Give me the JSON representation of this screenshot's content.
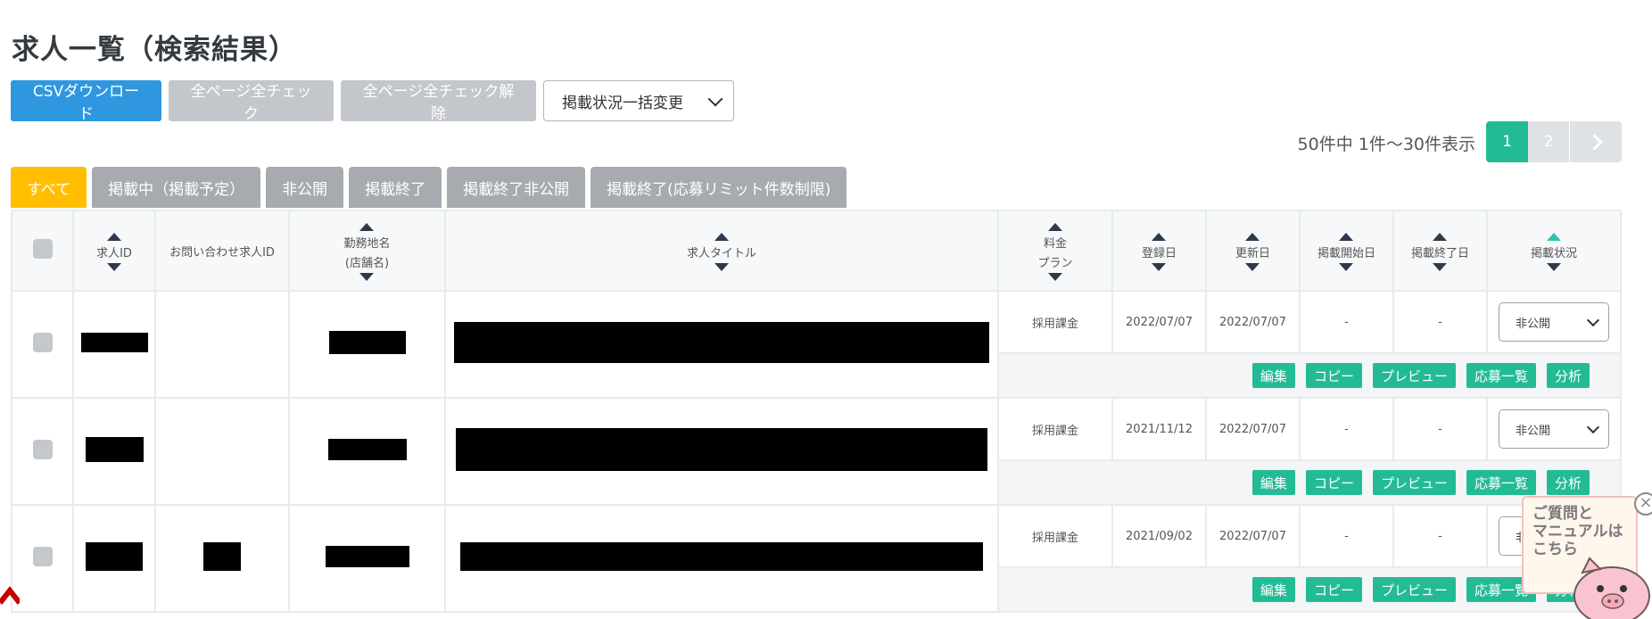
{
  "page": {
    "title": "求人一覧（検索結果）"
  },
  "toolbar": {
    "csv_label": "CSVダウンロード",
    "check_all_label": "全ページ全チェック",
    "uncheck_all_label": "全ページ全チェック解除",
    "bulk_change_value": "掲載状況一括変更"
  },
  "results": {
    "count_text": "50件中 1件～30件表示"
  },
  "pagination": {
    "page1": "1",
    "page2": "2"
  },
  "tabs": [
    {
      "label": "すべて",
      "active": true
    },
    {
      "label": "掲載中（掲載予定）"
    },
    {
      "label": "非公開"
    },
    {
      "label": "掲載終了"
    },
    {
      "label": "掲載終了非公開"
    },
    {
      "label": "掲載終了(応募リミット件数制限)"
    }
  ],
  "table": {
    "headers": {
      "job_id": "求人ID",
      "inquiry_id": "お問い合わせ求人ID",
      "location_line1": "勤務地名",
      "location_line2": "(店舗名)",
      "job_title": "求人タイトル",
      "plan_line1": "料金",
      "plan_line2": "プラン",
      "registered": "登録日",
      "updated": "更新日",
      "pub_start": "掲載開始日",
      "pub_end": "掲載終了日",
      "status": "掲載状況"
    },
    "rows": [
      {
        "plan": "採用課金",
        "registered": "2022/07/07",
        "updated": "2022/07/07",
        "pub_start": "-",
        "pub_end": "-",
        "status": "非公開"
      },
      {
        "plan": "採用課金",
        "registered": "2021/11/12",
        "updated": "2022/07/07",
        "pub_start": "-",
        "pub_end": "-",
        "status": "非公開"
      },
      {
        "plan": "採用課金",
        "registered": "2021/09/02",
        "updated": "2022/07/07",
        "pub_start": "-",
        "pub_end": "-",
        "status": "非"
      }
    ],
    "actions": {
      "edit": "編集",
      "copy": "コピー",
      "preview": "プレビュー",
      "applicants": "応募一覧",
      "analysis": "分析"
    }
  },
  "help": {
    "line1": "ご質問と",
    "line2": "マニュアルは",
    "line3": "こちら"
  },
  "colors": {
    "primary": "#2f97e0",
    "accent": "#23bb95",
    "tab_active": "#ffbf00",
    "tab_inactive": "#a7abb0"
  },
  "icons": {
    "sort": "sort-arrows-icon",
    "close": "close-icon",
    "mascot": "pig-mascot-icon",
    "scroll_top": "chevron-up-icon"
  }
}
